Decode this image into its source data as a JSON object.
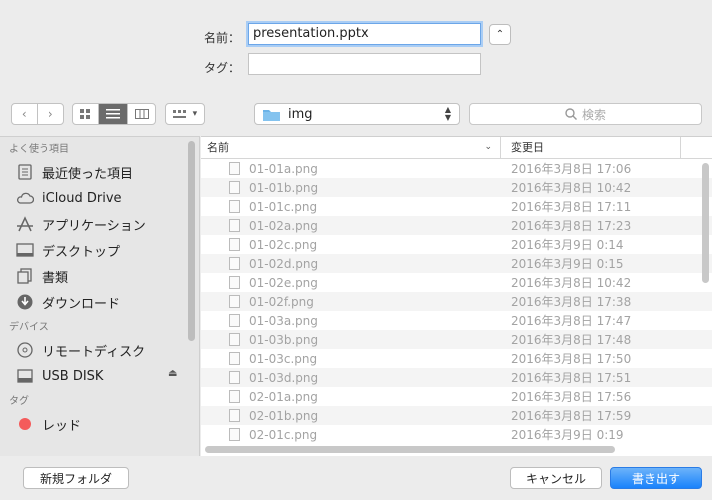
{
  "save": {
    "name_label": "名前：",
    "name_value": "presentation.pptx",
    "tag_label": "タグ：",
    "tag_value": "",
    "expand_glyph": "⌃"
  },
  "toolbar": {
    "location": "img",
    "search_placeholder": "検索"
  },
  "sidebar": {
    "favorites_heading": "よく使う項目",
    "favorites": [
      {
        "label": "最近使った項目",
        "icon": "recents-icon"
      },
      {
        "label": "iCloud Drive",
        "icon": "cloud-icon"
      },
      {
        "label": "アプリケーション",
        "icon": "applications-icon"
      },
      {
        "label": "デスクトップ",
        "icon": "desktop-icon"
      },
      {
        "label": "書類",
        "icon": "documents-icon"
      },
      {
        "label": "ダウンロード",
        "icon": "downloads-icon"
      }
    ],
    "devices_heading": "デバイス",
    "devices": [
      {
        "label": "リモートディスク",
        "icon": "remote-disc-icon"
      },
      {
        "label": "USB DISK",
        "icon": "usb-disk-icon"
      }
    ],
    "tags_heading": "タグ",
    "tags": [
      {
        "label": "レッド",
        "color": "#f45b5b"
      }
    ]
  },
  "list": {
    "col_name": "名前",
    "col_modified": "変更日",
    "files": [
      {
        "name": "01-01a.png",
        "modified": "2016年3月8日 17:06"
      },
      {
        "name": "01-01b.png",
        "modified": "2016年3月8日 10:42"
      },
      {
        "name": "01-01c.png",
        "modified": "2016年3月8日 17:11"
      },
      {
        "name": "01-02a.png",
        "modified": "2016年3月8日 17:23"
      },
      {
        "name": "01-02c.png",
        "modified": "2016年3月9日 0:14"
      },
      {
        "name": "01-02d.png",
        "modified": "2016年3月9日 0:15"
      },
      {
        "name": "01-02e.png",
        "modified": "2016年3月8日 10:42"
      },
      {
        "name": "01-02f.png",
        "modified": "2016年3月8日 17:38"
      },
      {
        "name": "01-03a.png",
        "modified": "2016年3月8日 17:47"
      },
      {
        "name": "01-03b.png",
        "modified": "2016年3月8日 17:48"
      },
      {
        "name": "01-03c.png",
        "modified": "2016年3月8日 17:50"
      },
      {
        "name": "01-03d.png",
        "modified": "2016年3月8日 17:51"
      },
      {
        "name": "02-01a.png",
        "modified": "2016年3月8日 17:56"
      },
      {
        "name": "02-01b.png",
        "modified": "2016年3月8日 17:59"
      },
      {
        "name": "02-01c.png",
        "modified": "2016年3月9日 0:19"
      }
    ]
  },
  "buttons": {
    "new_folder": "新規フォルダ",
    "cancel": "キャンセル",
    "save": "書き出す"
  }
}
